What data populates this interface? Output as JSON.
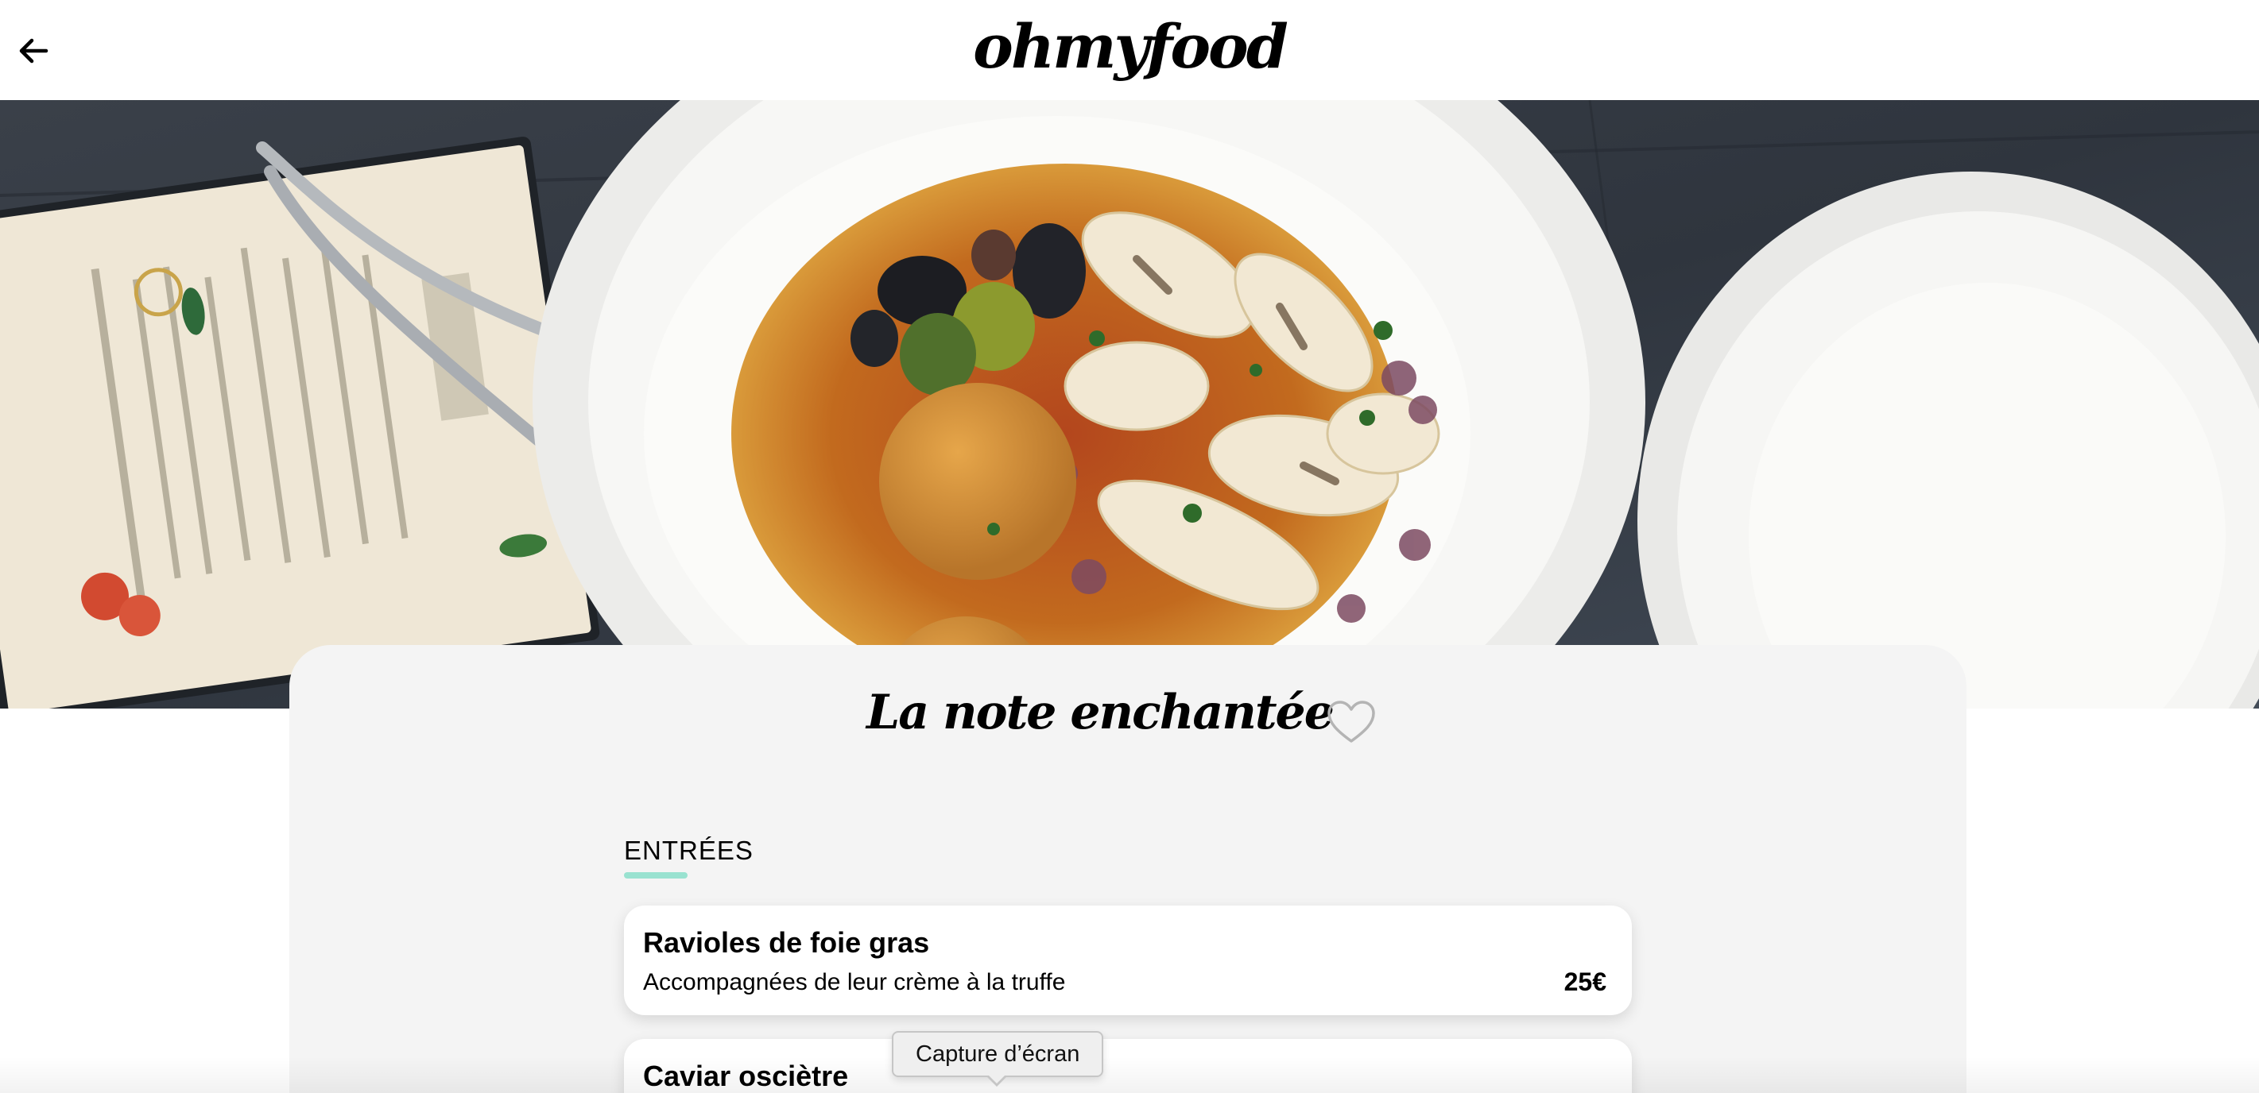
{
  "header": {
    "logo": "ohmyfood",
    "back_icon": "arrow-left-icon"
  },
  "hero": {
    "image_icon": "hero-food-photo"
  },
  "restaurant": {
    "name": "La note enchantée",
    "favorite_icon": "heart-outline-icon"
  },
  "menu": {
    "section_label": "ENTRÉES",
    "accent_color": "#99e2d0",
    "dishes": [
      {
        "name": "Ravioles de foie gras",
        "description": "Accompagnées de leur crème à la truffe",
        "price": "25€"
      },
      {
        "name": "Caviar osciètre"
      }
    ]
  },
  "tooltip": {
    "text": "Capture d’écran"
  }
}
